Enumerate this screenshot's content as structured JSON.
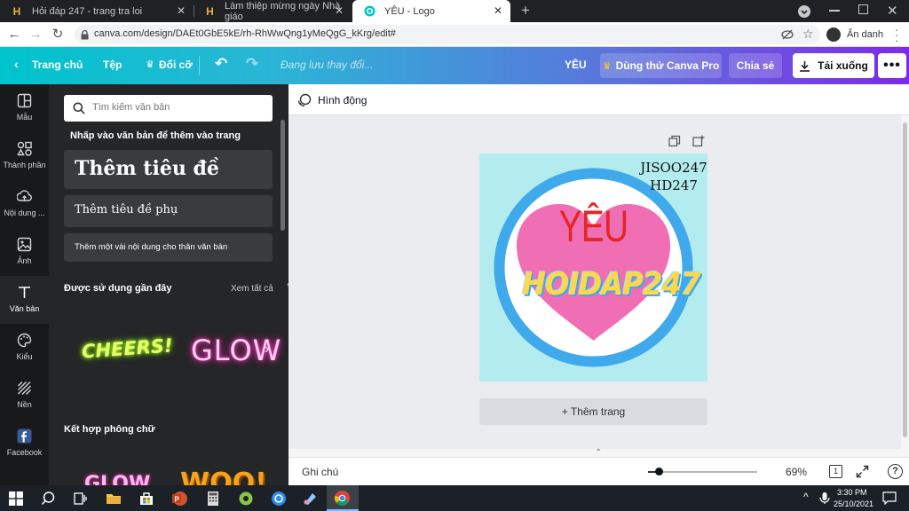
{
  "browser": {
    "tabs": [
      {
        "title": "Hỏi đáp 247 - trang tra loi",
        "favicon": "hoidap247-icon"
      },
      {
        "title": "Làm thiệp mừng ngày Nhà giáo",
        "favicon": "hoidap247-icon"
      },
      {
        "title": "YÊU - Logo",
        "favicon": "canva-icon",
        "active": true
      }
    ],
    "url": "canva.com/design/DAEt0GbE5kE/rh-RhWwQng1yMeQgG_kKrg/edit#",
    "profile_label": "Ẩn danh"
  },
  "canva_toolbar": {
    "home": "Trang chủ",
    "file": "Tệp",
    "resize": "Đổi cỡ",
    "saving_status": "Đang lưu thay đổi...",
    "design_title": "YÊU",
    "try_pro": "Dùng thử Canva Pro",
    "share": "Chia sẻ",
    "download": "Tải xuống"
  },
  "rail": [
    {
      "label": "Mẫu",
      "icon": "template-icon"
    },
    {
      "label": "Thành phần",
      "icon": "elements-icon"
    },
    {
      "label": "Nội dung ...",
      "icon": "upload-icon"
    },
    {
      "label": "Ảnh",
      "icon": "photo-icon"
    },
    {
      "label": "Văn bản",
      "icon": "text-icon",
      "active": true
    },
    {
      "label": "Kiểu",
      "icon": "palette-icon"
    },
    {
      "label": "Nền",
      "icon": "background-icon"
    },
    {
      "label": "Facebook",
      "icon": "facebook-icon"
    }
  ],
  "panel": {
    "search_placeholder": "Tìm kiếm văn bản",
    "instruction": "Nhấp vào văn bản để thêm vào trang",
    "add_heading": "Thêm tiêu đề",
    "add_subheading": "Thêm tiêu đề phụ",
    "add_body": "Thêm một vài nội dung cho thân văn bản",
    "recent_title": "Được sử dụng gần đây",
    "see_all": "Xem tất cả",
    "recent_items": [
      "CHEERS!",
      "GLOW"
    ],
    "combos_title": "Kết hợp phông chữ",
    "combo_preview": [
      "GLOW",
      "WOO!"
    ]
  },
  "workspace": {
    "animate": "Hình động",
    "design_text": {
      "watermark_line1": "JISOO247",
      "watermark_line2": "HD247",
      "main_word": "YÊU",
      "brand": "HOIDAP247"
    },
    "add_page": "+ Thêm trang"
  },
  "footer": {
    "notes": "Ghi chú",
    "zoom": "69%",
    "page_count": "1",
    "zoom_fraction": 0.1
  },
  "taskbar": {
    "time": "3:30 PM",
    "date": "25/10/2021"
  },
  "colors": {
    "canva_teal": "#00c4cc",
    "canva_purple": "#7d2ae8",
    "heart_pink": "#f06fb4",
    "ring_blue": "#3fa9ec",
    "canvas_bg": "#b3ecef",
    "yeu_red": "#e32626"
  }
}
